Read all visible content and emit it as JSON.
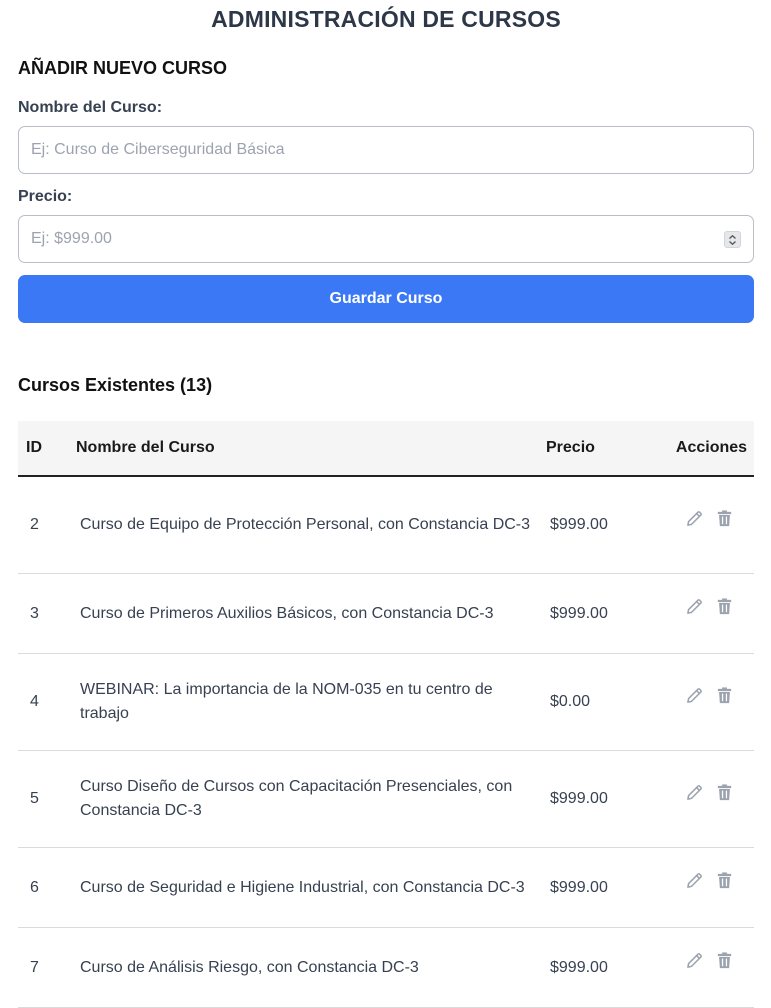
{
  "header": {
    "title": "ADMINISTRACIÓN DE CURSOS"
  },
  "form": {
    "section_title": "AÑADIR NUEVO CURSO",
    "name_label": "Nombre del Curso:",
    "name_placeholder": "Ej: Curso de Ciberseguridad Básica",
    "name_value": "",
    "price_label": "Precio:",
    "price_placeholder": "Ej: $999.00",
    "price_value": "",
    "save_label": "Guardar Curso"
  },
  "list": {
    "title": "Cursos Existentes (13)",
    "columns": {
      "id": "ID",
      "name": "Nombre del Curso",
      "price": "Precio",
      "actions": "Acciones"
    },
    "rows": [
      {
        "id": "2",
        "name": "Curso de Equipo de Protección Personal, con Constancia DC-3",
        "price": "$999.00"
      },
      {
        "id": "3",
        "name": "Curso de Primeros Auxilios Básicos, con Constancia DC-3",
        "price": "$999.00"
      },
      {
        "id": "4",
        "name": "WEBINAR: La importancia de la NOM-035 en tu centro de trabajo",
        "price": "$0.00"
      },
      {
        "id": "5",
        "name": "Curso Diseño de Cursos con Capacitación Presenciales, con Constancia DC-3",
        "price": "$999.00"
      },
      {
        "id": "6",
        "name": "Curso de Seguridad e Higiene Industrial, con Constancia DC-3",
        "price": "$999.00"
      },
      {
        "id": "7",
        "name": "Curso de Análisis Riesgo, con Constancia DC-3",
        "price": "$999.00"
      }
    ]
  },
  "icons": {
    "edit": "pencil-icon",
    "delete": "trash-icon",
    "spinner": "number-spinner-icon"
  },
  "colors": {
    "primary": "#3b78f6",
    "icon": "#9ca3af",
    "title": "#2d3748"
  }
}
